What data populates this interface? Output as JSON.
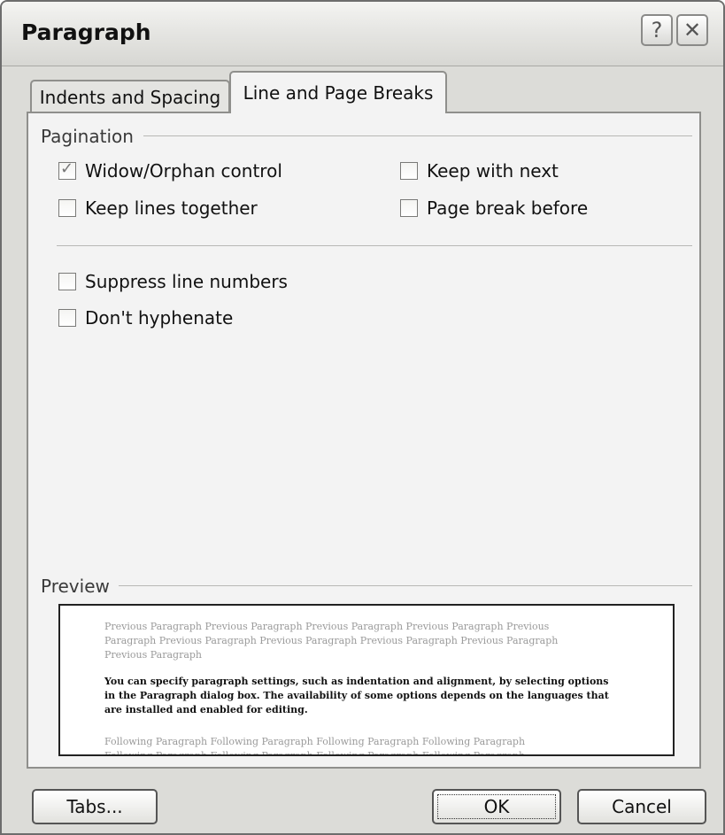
{
  "dialog": {
    "title": "Paragraph",
    "help_glyph": "?",
    "close_glyph": "✕"
  },
  "tabs": [
    {
      "label": "Indents and Spacing",
      "active": false
    },
    {
      "label": "Line and Page Breaks",
      "active": true
    }
  ],
  "pagination": {
    "label": "Pagination",
    "options": [
      {
        "label": "Widow/Orphan control",
        "checked": true
      },
      {
        "label": "Keep with next",
        "checked": false
      },
      {
        "label": "Keep lines together",
        "checked": false
      },
      {
        "label": "Page break before",
        "checked": false
      }
    ]
  },
  "formatting": {
    "options": [
      {
        "label": "Suppress line numbers",
        "checked": false
      },
      {
        "label": "Don't hyphenate",
        "checked": false
      }
    ]
  },
  "preview": {
    "label": "Preview",
    "previous_line1": "Previous Paragraph Previous Paragraph Previous Paragraph Previous Paragraph Previous",
    "previous_line2": "Paragraph Previous Paragraph Previous Paragraph Previous Paragraph Previous Paragraph",
    "previous_line3": "Previous Paragraph",
    "sample_line1": "You can specify paragraph settings, such as indentation and alignment, by selecting options",
    "sample_line2": "in the Paragraph dialog box. The availability of some options depends on the languages that",
    "sample_line3": "are installed and enabled for editing.",
    "following_line1": "Following Paragraph Following Paragraph Following Paragraph Following Paragraph",
    "following_line2": "Following Paragraph Following Paragraph Following Paragraph Following Paragraph"
  },
  "buttons": {
    "tabs": "Tabs...",
    "ok": "OK",
    "cancel": "Cancel"
  }
}
